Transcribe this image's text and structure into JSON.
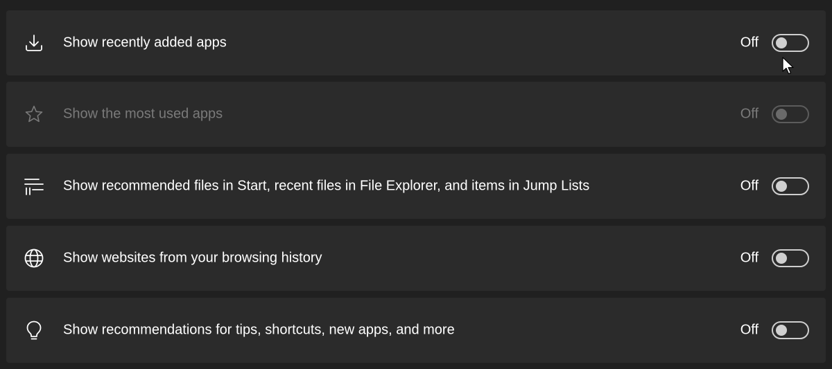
{
  "settings": [
    {
      "icon": "download-icon",
      "label": "Show recently added apps",
      "state": "Off",
      "enabled": true,
      "toggle_on": false
    },
    {
      "icon": "star-icon",
      "label": "Show the most used apps",
      "state": "Off",
      "enabled": false,
      "toggle_on": false
    },
    {
      "icon": "list-icon",
      "label": "Show recommended files in Start, recent files in File Explorer, and items in Jump Lists",
      "state": "Off",
      "enabled": true,
      "toggle_on": false
    },
    {
      "icon": "globe-icon",
      "label": "Show websites from your browsing history",
      "state": "Off",
      "enabled": true,
      "toggle_on": false
    },
    {
      "icon": "lightbulb-icon",
      "label": "Show recommendations for tips, shortcuts, new apps, and more",
      "state": "Off",
      "enabled": true,
      "toggle_on": false
    }
  ],
  "colors": {
    "background": "#202020",
    "card": "#2b2b2b",
    "text": "#ffffff",
    "disabled_text": "#7a7a7a"
  }
}
